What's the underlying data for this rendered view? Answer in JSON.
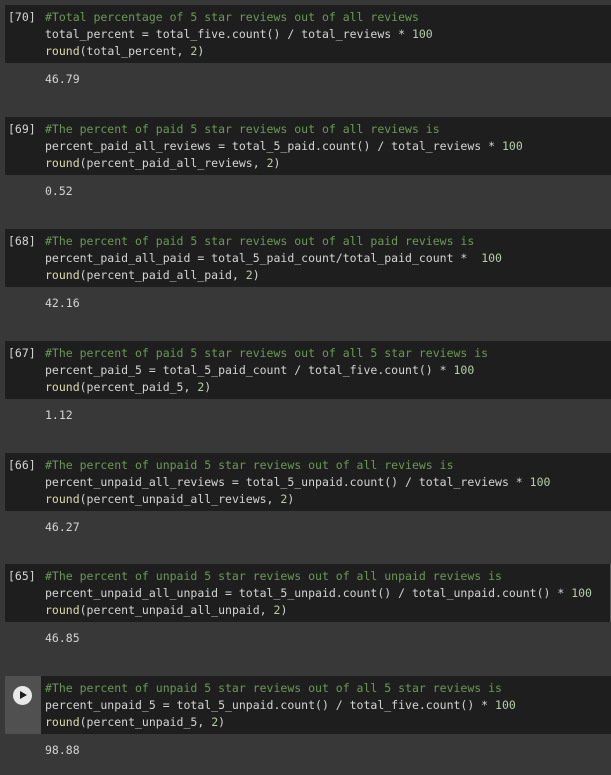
{
  "cells": [
    {
      "exec_count": "[70]",
      "comment": "#Total percentage of 5 star reviews out of all reviews",
      "line2": {
        "text": "total_percent = total_five.count() / total_reviews * ",
        "num": "100"
      },
      "line3": {
        "fn": "round",
        "args": "(total_percent, ",
        "num": "2",
        "close": ")"
      },
      "output": "46.79"
    },
    {
      "exec_count": "[69]",
      "comment": "#The percent of paid 5 star reviews out of all reviews is",
      "line2": {
        "text": "percent_paid_all_reviews = total_5_paid.count() / total_reviews * ",
        "num": "100"
      },
      "line3": {
        "fn": "round",
        "args": "(percent_paid_all_reviews, ",
        "num": "2",
        "close": ")"
      },
      "output": "0.52"
    },
    {
      "exec_count": "[68]",
      "comment": "#The percent of paid 5 star reviews out of all paid reviews is",
      "line2": {
        "text": "percent_paid_all_paid = total_5_paid_count/total_paid_count *  ",
        "num": "100"
      },
      "line3": {
        "fn": "round",
        "args": "(percent_paid_all_paid, ",
        "num": "2",
        "close": ")"
      },
      "output": "42.16"
    },
    {
      "exec_count": "[67]",
      "comment": "#The percent of paid 5 star reviews out of all 5 star reviews is",
      "line2": {
        "text": "percent_paid_5 = total_5_paid_count / total_five.count() * ",
        "num": "100"
      },
      "line3": {
        "fn": "round",
        "args": "(percent_paid_5, ",
        "num": "2",
        "close": ")"
      },
      "output": "1.12"
    },
    {
      "exec_count": "[66]",
      "comment": "#The percent of unpaid 5 star reviews out of all reviews is",
      "line2": {
        "text": "percent_unpaid_all_reviews = total_5_unpaid.count() / total_reviews * ",
        "num": "100"
      },
      "line3": {
        "fn": "round",
        "args": "(percent_unpaid_all_reviews, ",
        "num": "2",
        "close": ")"
      },
      "output": "46.27"
    },
    {
      "exec_count": "[65]",
      "comment": "#The percent of unpaid 5 star reviews out of all unpaid reviews is",
      "line2": {
        "text": "percent_unpaid_all_unpaid = total_5_unpaid.count() / total_unpaid.count() * ",
        "num": "100"
      },
      "line3": {
        "fn": "round",
        "args": "(percent_unpaid_all_unpaid, ",
        "num": "2",
        "close": ")"
      },
      "output": "46.85"
    },
    {
      "exec_count": "",
      "comment": "#The percent of unpaid 5 star reviews out of all 5 star reviews is",
      "line2": {
        "text": "percent_unpaid_5 = total_5_unpaid.count() / total_five.count() * ",
        "num": "100"
      },
      "line3": {
        "fn": "round",
        "args": "(percent_unpaid_5, ",
        "num": "2",
        "close": ")"
      },
      "output": "98.88"
    }
  ]
}
